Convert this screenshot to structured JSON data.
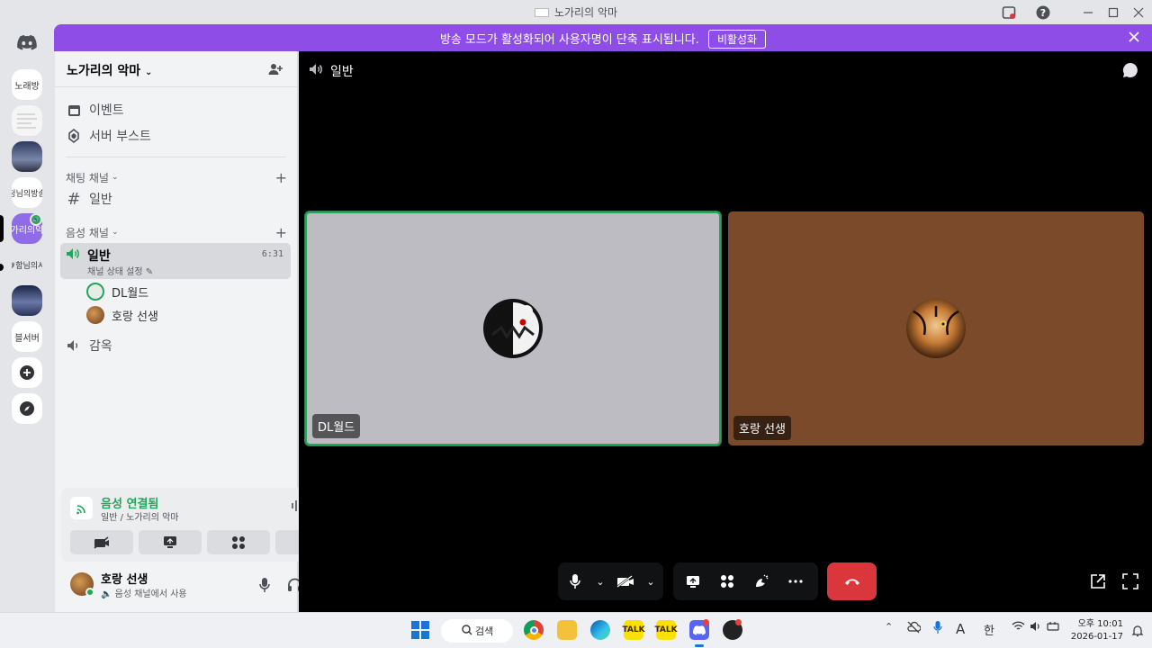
{
  "window": {
    "title": "노가리의 악마"
  },
  "rail": {
    "servers": [
      "노래방",
      "",
      "",
      "청님의방송",
      "가리의악",
      "#함님의서",
      "",
      "블서버"
    ],
    "active_badge": "🔊"
  },
  "banner": {
    "text": "방송 모드가 활성화되어 사용자명이 단축 표시됩니다.",
    "button_label": "비활성화"
  },
  "server": {
    "name": "노가리의 악마",
    "top_items": [
      {
        "label": "이벤트",
        "icon": "calendar-icon"
      },
      {
        "label": "서버 부스트",
        "icon": "boost-gem-icon"
      }
    ],
    "text_category": "채팅 채널",
    "text_channels": [
      "일반"
    ],
    "voice_category": "음성 채널",
    "voice_channels": [
      {
        "name": "일반",
        "timer": "6:31",
        "status_label": "채널 상태 설정",
        "users": [
          "DL월드",
          "호랑 선생"
        ]
      },
      {
        "name": "감옥"
      }
    ]
  },
  "voice_panel": {
    "status": "음성 연결됨",
    "location": "일반 / 노가리의 악마",
    "colors": {
      "connected": "#23a55a"
    }
  },
  "user_panel": {
    "name": "호랑 선생",
    "status": "음성 채널에서 사용"
  },
  "main": {
    "channel_name": "일반",
    "tiles": [
      {
        "name": "DL월드",
        "bg": "#bcbcc2",
        "speaking": true
      },
      {
        "name": "호랑 선생",
        "bg": "#7a4a2a",
        "speaking": false
      }
    ]
  },
  "taskbar": {
    "search_label": "검색",
    "ime_label": "한",
    "font_label": "A",
    "time": "오후 10:01",
    "date": "2026-01-17",
    "kakao_label": "TALK"
  }
}
